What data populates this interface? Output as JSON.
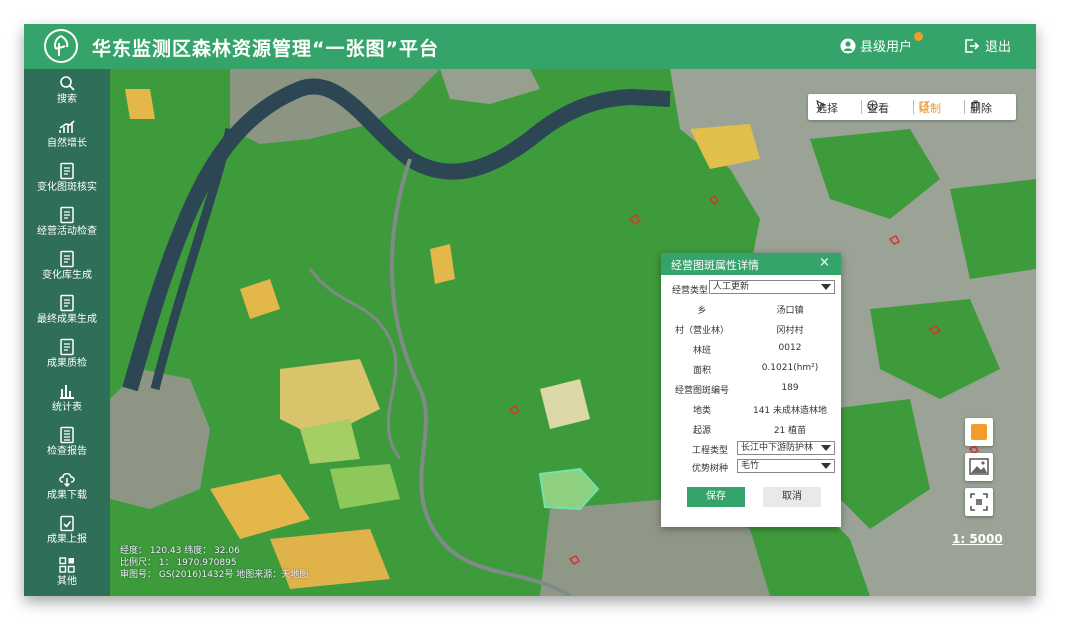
{
  "header": {
    "title": "华东监测区森林资源管理“一张图”平台",
    "user_label": "县级用户",
    "logout_label": "退出"
  },
  "sidebar": {
    "items": [
      {
        "label": "搜索",
        "icon": "search-icon"
      },
      {
        "label": "自然增长",
        "icon": "growth-chart-icon"
      },
      {
        "label": "变化图斑核实",
        "icon": "document-icon"
      },
      {
        "label": "经营活动检查",
        "icon": "document-icon"
      },
      {
        "label": "变化库生成",
        "icon": "document-icon"
      },
      {
        "label": "最终成果生成",
        "icon": "document-icon"
      },
      {
        "label": "成果质检",
        "icon": "document-icon"
      },
      {
        "label": "统计表",
        "icon": "bar-chart-icon"
      },
      {
        "label": "检查报告",
        "icon": "report-icon"
      },
      {
        "label": "成果下载",
        "icon": "cloud-download-icon"
      },
      {
        "label": "成果上报",
        "icon": "upload-check-icon"
      },
      {
        "label": "其他",
        "icon": "grid-icon"
      }
    ]
  },
  "toolbar": {
    "select_label": "选择",
    "view_label": "查看",
    "draw_label": "绘制",
    "delete_label": "删除"
  },
  "map_info": {
    "coords": "经度： 120.43 纬度： 32.06",
    "scale_ratio": "比例尺： 1： 1970.970895",
    "review_no": "审图号： GS(2016)1432号  地图来源：天地图"
  },
  "scale_bar": "1: 5000",
  "dialog": {
    "title": "经营图斑属性详情",
    "close": "×",
    "type_label": "经营类型",
    "type_value": "人工更新",
    "rows": [
      {
        "label": "乡",
        "value": "汤口镇"
      },
      {
        "label": "村（营业林）",
        "value": "冈村村"
      },
      {
        "label": "林班",
        "value": "0012"
      },
      {
        "label": "面积",
        "value": "0.1021(hm²)"
      },
      {
        "label": "经营图斑编号",
        "value": "189"
      },
      {
        "label": "地类",
        "value": "141 未成林造林地"
      },
      {
        "label": "起源",
        "value": "21  植苗"
      }
    ],
    "project_label": "工程类型",
    "project_value": "长江中下游防护林",
    "species_label": "优势树种",
    "species_value": "毛竹",
    "save_label": "保存",
    "cancel_label": "取消"
  },
  "colors": {
    "brand_green": "#35a46a",
    "sidebar_green": "#2f6e57",
    "forest_green": "#3e9b3c",
    "accent_orange": "#f39c2c"
  }
}
